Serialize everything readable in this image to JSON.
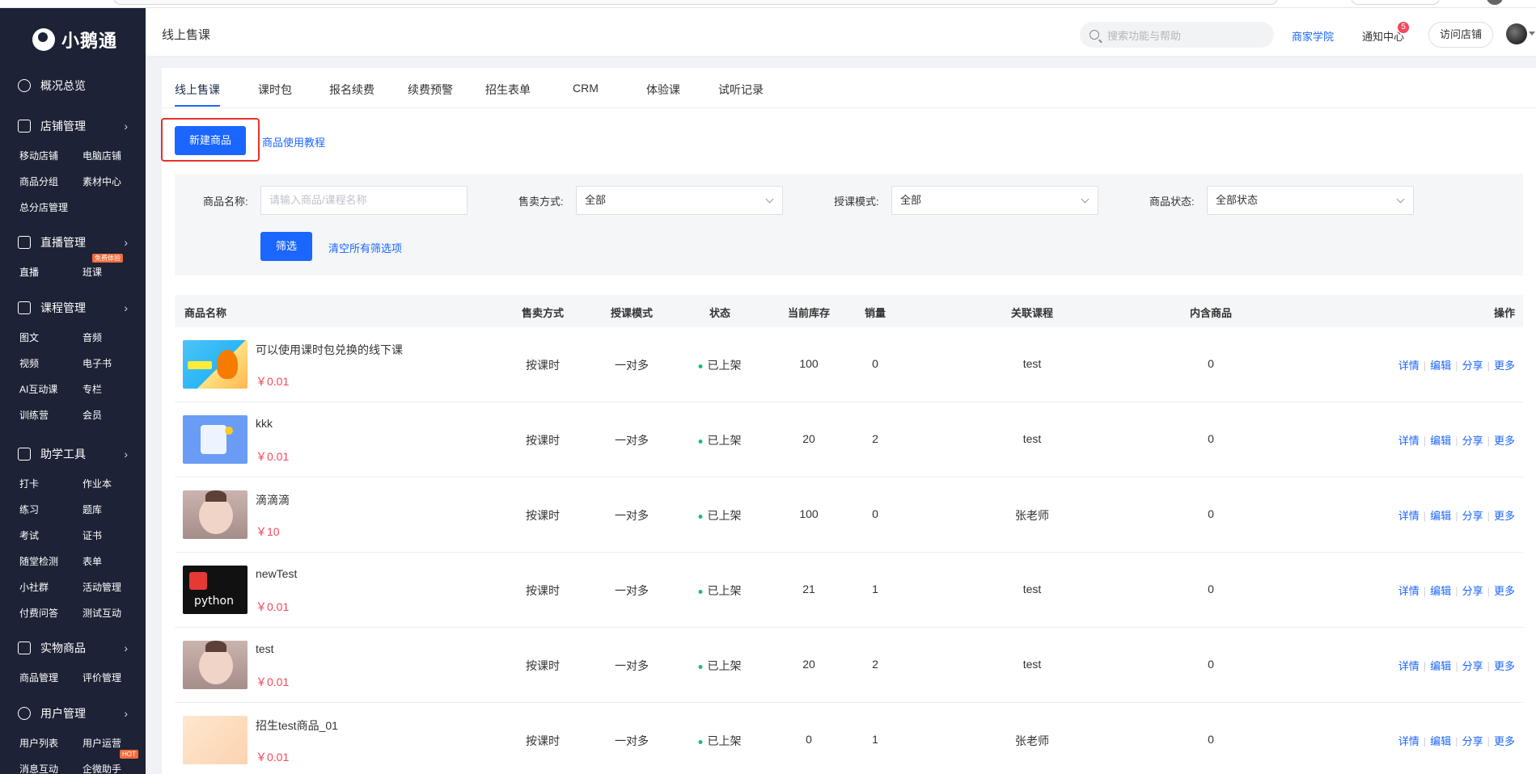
{
  "sidebar": {
    "logo_text": "小鹅通",
    "overview": "概况总览",
    "groups": {
      "store": {
        "label": "店铺管理",
        "items": [
          "移动店铺",
          "电脑店铺",
          "商品分组",
          "素材中心",
          "总分店管理"
        ]
      },
      "live": {
        "label": "直播管理",
        "items": [
          "直播",
          "班课"
        ],
        "badge": "免费体验"
      },
      "course": {
        "label": "课程管理",
        "items": [
          "图文",
          "音频",
          "视频",
          "电子书",
          "AI互动课",
          "专栏",
          "训练营",
          "会员"
        ]
      },
      "tools": {
        "label": "助学工具",
        "items": [
          "打卡",
          "作业本",
          "练习",
          "题库",
          "考试",
          "证书",
          "随堂检测",
          "表单",
          "小社群",
          "活动管理",
          "付费问答",
          "测试互动"
        ]
      },
      "physical": {
        "label": "实物商品",
        "items": [
          "商品管理",
          "评价管理"
        ]
      },
      "users": {
        "label": "用户管理",
        "items": [
          "用户列表",
          "用户运营",
          "消息互动",
          "企微助手"
        ],
        "badge": "HOT"
      }
    }
  },
  "header": {
    "title": "线上售课",
    "search_placeholder": "搜索功能与帮助",
    "academy": "商家学院",
    "notify": "通知中心",
    "notify_count": "5",
    "visit": "访问店铺"
  },
  "tabs": [
    "线上售课",
    "课时包",
    "报名续费",
    "续费预警",
    "招生表单",
    "CRM",
    "体验课",
    "试听记录"
  ],
  "actions": {
    "new_product": "新建商品",
    "tutorial": "商品使用教程"
  },
  "filters": {
    "name_label": "商品名称:",
    "name_placeholder": "请输入商品/课程名称",
    "sale_label": "售卖方式:",
    "sale_value": "全部",
    "mode_label": "授课模式:",
    "mode_value": "全部",
    "status_label": "商品状态:",
    "status_value": "全部状态",
    "filter_btn": "筛选",
    "clear": "清空所有筛选项"
  },
  "table": {
    "headers": [
      "商品名称",
      "售卖方式",
      "授课模式",
      "状态",
      "当前库存",
      "销量",
      "关联课程",
      "内含商品",
      "操作"
    ],
    "ops": [
      "详情",
      "编辑",
      "分享",
      "更多"
    ],
    "rows": [
      {
        "name": "可以使用课时包兑换的线下课",
        "price": "￥0.01",
        "sale": "按课时",
        "mode": "一对多",
        "status": "已上架",
        "stock": "100",
        "sales": "0",
        "course": "test",
        "inner": "0",
        "thumb": "cartoon-fox"
      },
      {
        "name": "kkk",
        "price": "￥0.01",
        "sale": "按课时",
        "mode": "一对多",
        "status": "已上架",
        "stock": "20",
        "sales": "2",
        "course": "test",
        "inner": "0",
        "thumb": "blue-document"
      },
      {
        "name": "滴滴滴",
        "price": "￥10",
        "sale": "按课时",
        "mode": "一对多",
        "status": "已上架",
        "stock": "100",
        "sales": "0",
        "course": "张老师",
        "inner": "0",
        "thumb": "baby-photo"
      },
      {
        "name": "newTest",
        "price": "￥0.01",
        "sale": "按课时",
        "mode": "一对多",
        "status": "已上架",
        "stock": "21",
        "sales": "1",
        "course": "test",
        "inner": "0",
        "thumb": "python-logo"
      },
      {
        "name": "test",
        "price": "￥0.01",
        "sale": "按课时",
        "mode": "一对多",
        "status": "已上架",
        "stock": "20",
        "sales": "2",
        "course": "test",
        "inner": "0",
        "thumb": "baby-photo"
      },
      {
        "name": "招生test商品_01",
        "price": "￥0.01",
        "sale": "按课时",
        "mode": "一对多",
        "status": "已上架",
        "stock": "0",
        "sales": "1",
        "course": "张老师",
        "inner": "0",
        "thumb": "peach-gradient"
      }
    ]
  },
  "colors": {
    "sidebar_bg": "#1d2236",
    "primary": "#1a66ff",
    "price": "#f5475a",
    "status_on": "#1bbf6a",
    "highlight": "#e8302c"
  }
}
